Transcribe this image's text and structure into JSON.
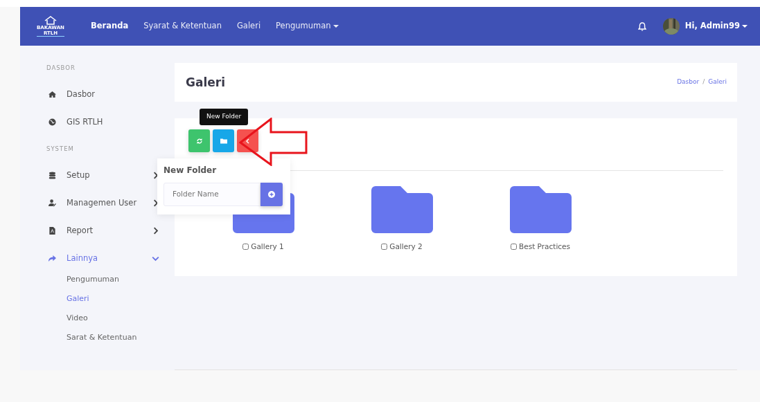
{
  "navbar": {
    "logo": [
      "BAKAWAN",
      "RTLH"
    ],
    "links": [
      {
        "label": "Beranda",
        "selected": true,
        "dropdown": false
      },
      {
        "label": "Syarat & Ketentuan",
        "selected": false,
        "dropdown": false
      },
      {
        "label": "Galeri",
        "selected": false,
        "dropdown": false
      },
      {
        "label": "Pengumuman",
        "selected": false,
        "dropdown": true
      }
    ],
    "user": "Hi, Admin99"
  },
  "sidebar": [
    {
      "heading": "DASBOR",
      "items": [
        {
          "kind": "home",
          "label": "Dasbor",
          "selected": false
        },
        {
          "kind": "globe",
          "label": "GIS RTLH",
          "selected": false
        }
      ]
    },
    {
      "heading": "SYSTEM",
      "items": [
        {
          "kind": "database",
          "label": "Setup",
          "selected": false,
          "expanded": false
        },
        {
          "kind": "user",
          "label": "Managemen User",
          "selected": false,
          "expanded": false
        },
        {
          "kind": "file",
          "label": "Report",
          "selected": false,
          "expanded": false
        },
        {
          "kind": "share",
          "label": "Lainnya",
          "selected": true,
          "expanded": true,
          "children": [
            {
              "label": "Pengumuman",
              "selected": false
            },
            {
              "label": "Galeri",
              "selected": true
            },
            {
              "label": "Video",
              "selected": false
            },
            {
              "label": "Sarat & Ketentuan",
              "selected": false
            }
          ]
        }
      ]
    }
  ],
  "page": {
    "title": "Galeri",
    "breadcrumb": [
      "Dasbor",
      "/",
      "Galeri"
    ]
  },
  "toolbar": [
    {
      "kind": "refresh"
    },
    {
      "kind": "folder"
    },
    {
      "kind": "back"
    }
  ],
  "tooltip": "New Folder",
  "popover": {
    "title": "New Folder",
    "placeholder": "Folder Name"
  },
  "folders": [
    {
      "name": "Gallery 1",
      "checked": false
    },
    {
      "name": "Gallery 2",
      "checked": false
    },
    {
      "name": "Best Practices",
      "checked": false
    }
  ]
}
